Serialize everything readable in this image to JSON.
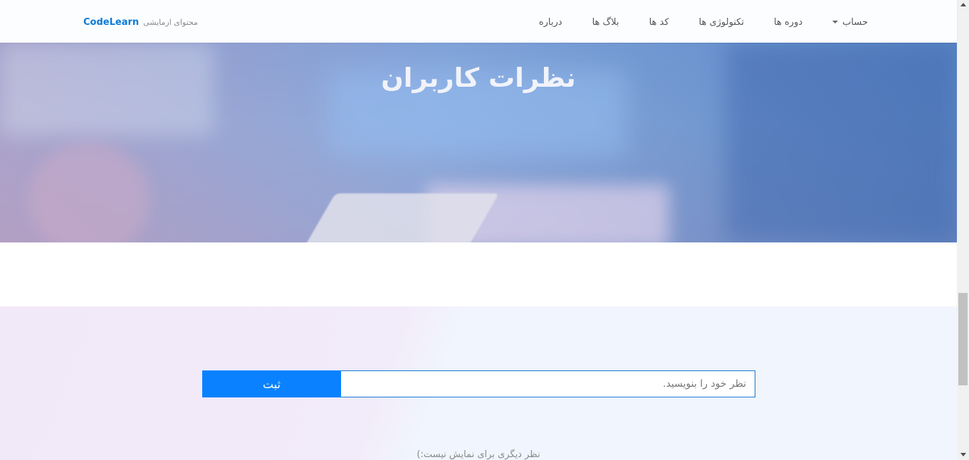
{
  "navbar": {
    "brand": "CodeLearn",
    "brand_sub": "محتوای ازمایشی",
    "items": [
      {
        "label": "حساب"
      },
      {
        "label": "دوره ها"
      },
      {
        "label": "تکنولوژی ها"
      },
      {
        "label": "کد ها"
      },
      {
        "label": "بلاگ ها"
      },
      {
        "label": "درباره"
      }
    ]
  },
  "hero": {
    "title": "نظرات کاربران"
  },
  "comments": {
    "input_placeholder": "نظر خود را بنویسید.",
    "input_value": "",
    "submit_label": "ثبت",
    "empty_message": "نظر دیگری برای نمایش نیست:)"
  },
  "colors": {
    "brand": "#0a7bd8",
    "button": "#0a82ff",
    "input_border": "#1b78d0"
  }
}
